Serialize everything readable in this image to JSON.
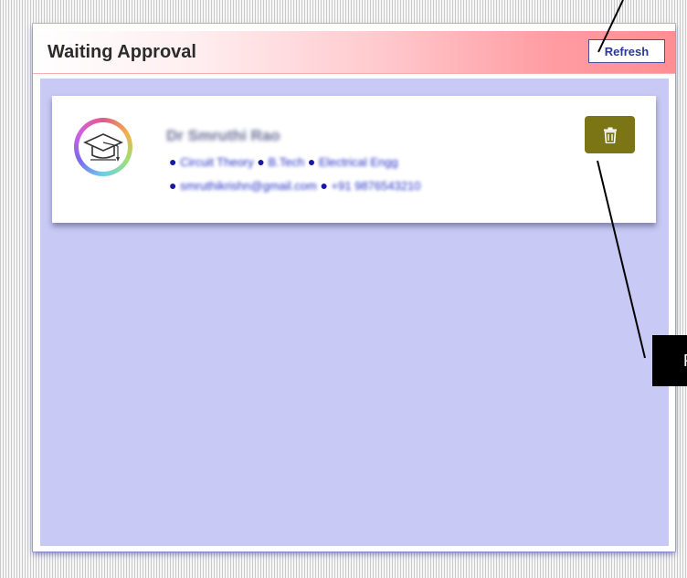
{
  "header": {
    "title": "Waiting Approval",
    "refresh_label": "Refresh"
  },
  "card": {
    "name": "Dr Smruthi Rao",
    "line1_items": [
      "Circuit Theory",
      "B.Tech",
      "Electrical Engg"
    ],
    "line2_items": [
      "smruthikrishn@gmail.com",
      "+91 9876543210"
    ]
  },
  "annotation": {
    "tooltip_text": "R"
  },
  "icons": {
    "avatar": "graduation-cap-icon",
    "delete": "trash-icon"
  },
  "colors": {
    "header_gradient_end": "#ff8e94",
    "content_bg": "#c8caf5",
    "delete_button": "#7b7516",
    "refresh_text": "#2b3990",
    "link_text": "#2431c4"
  }
}
